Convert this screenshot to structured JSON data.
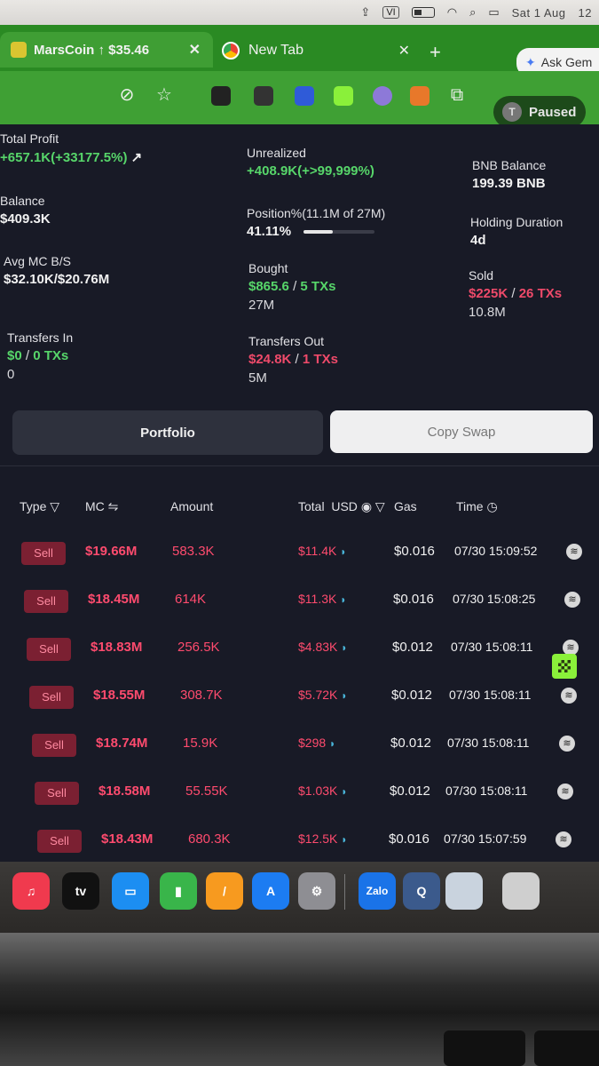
{
  "menubar": {
    "badge": "VI",
    "date": "Sat 1 Aug",
    "time": "12"
  },
  "browser": {
    "tabs": [
      {
        "label": "MarsCoin ↑ $35.46"
      },
      {
        "label": "New Tab"
      }
    ],
    "ask_gemini": "Ask Gem",
    "profile": {
      "initial": "T",
      "status": "Paused"
    }
  },
  "stats": {
    "total_profit": {
      "label": "Total Profit",
      "value": "+657.1K(+33177.5%)"
    },
    "unrealized": {
      "label": "Unrealized",
      "value": "+408.9K(+>99,999%)"
    },
    "bnb_balance": {
      "label": "BNB Balance",
      "value": "199.39 BNB"
    },
    "balance": {
      "label": "Balance",
      "value": "$409.3K"
    },
    "position": {
      "label": "Position%(11.1M of 27M)",
      "value": "41.11%",
      "fraction": 0.4111
    },
    "holding_duration": {
      "label": "Holding Duration",
      "value": "4d"
    },
    "avg_mc": {
      "label": "Avg MC B/S",
      "value": "$32.10K/$20.76M"
    },
    "bought": {
      "label": "Bought",
      "amount": "$865.6",
      "sep": "/",
      "txs": "5 TXs",
      "sub": "27M"
    },
    "sold": {
      "label": "Sold",
      "amount": "$225K",
      "sep": "/",
      "txs": "26 TXs",
      "sub": "10.8M"
    },
    "transfers_in": {
      "label": "Transfers In",
      "amount": "$0",
      "sep": "/",
      "txs": "0 TXs",
      "sub": "0"
    },
    "transfers_out": {
      "label": "Transfers Out",
      "amount": "$24.8K",
      "sep": "/",
      "txs": "1 TXs",
      "sub": "5M"
    }
  },
  "buttons": {
    "portfolio": "Portfolio",
    "copy_swap": "Copy Swap"
  },
  "table": {
    "headers": {
      "type": "Type",
      "mc": "MC",
      "amount": "Amount",
      "total": "Total",
      "usd": "USD",
      "gas": "Gas",
      "time": "Time"
    },
    "rows": [
      {
        "type": "Sell",
        "mc": "$19.66M",
        "amount": "583.3K",
        "total": "$11.4K",
        "gas": "$0.016",
        "time": "07/30 15:09:52"
      },
      {
        "type": "Sell",
        "mc": "$18.45M",
        "amount": "614K",
        "total": "$11.3K",
        "gas": "$0.016",
        "time": "07/30 15:08:25"
      },
      {
        "type": "Sell",
        "mc": "$18.83M",
        "amount": "256.5K",
        "total": "$4.83K",
        "gas": "$0.012",
        "time": "07/30 15:08:11"
      },
      {
        "type": "Sell",
        "mc": "$18.55M",
        "amount": "308.7K",
        "total": "$5.72K",
        "gas": "$0.012",
        "time": "07/30 15:08:11"
      },
      {
        "type": "Sell",
        "mc": "$18.74M",
        "amount": "15.9K",
        "total": "$298",
        "gas": "$0.012",
        "time": "07/30 15:08:11"
      },
      {
        "type": "Sell",
        "mc": "$18.58M",
        "amount": "55.55K",
        "total": "$1.03K",
        "gas": "$0.012",
        "time": "07/30 15:08:11"
      },
      {
        "type": "Sell",
        "mc": "$18.43M",
        "amount": "680.3K",
        "total": "$12.5K",
        "gas": "$0.016",
        "time": "07/30 15:07:59"
      }
    ]
  },
  "dock": {
    "tv_label": "tv",
    "zalo_label": "Zalo"
  },
  "colors": {
    "green": "#57d66a",
    "red": "#ef4a6a",
    "tab_green": "#3f9e34"
  }
}
